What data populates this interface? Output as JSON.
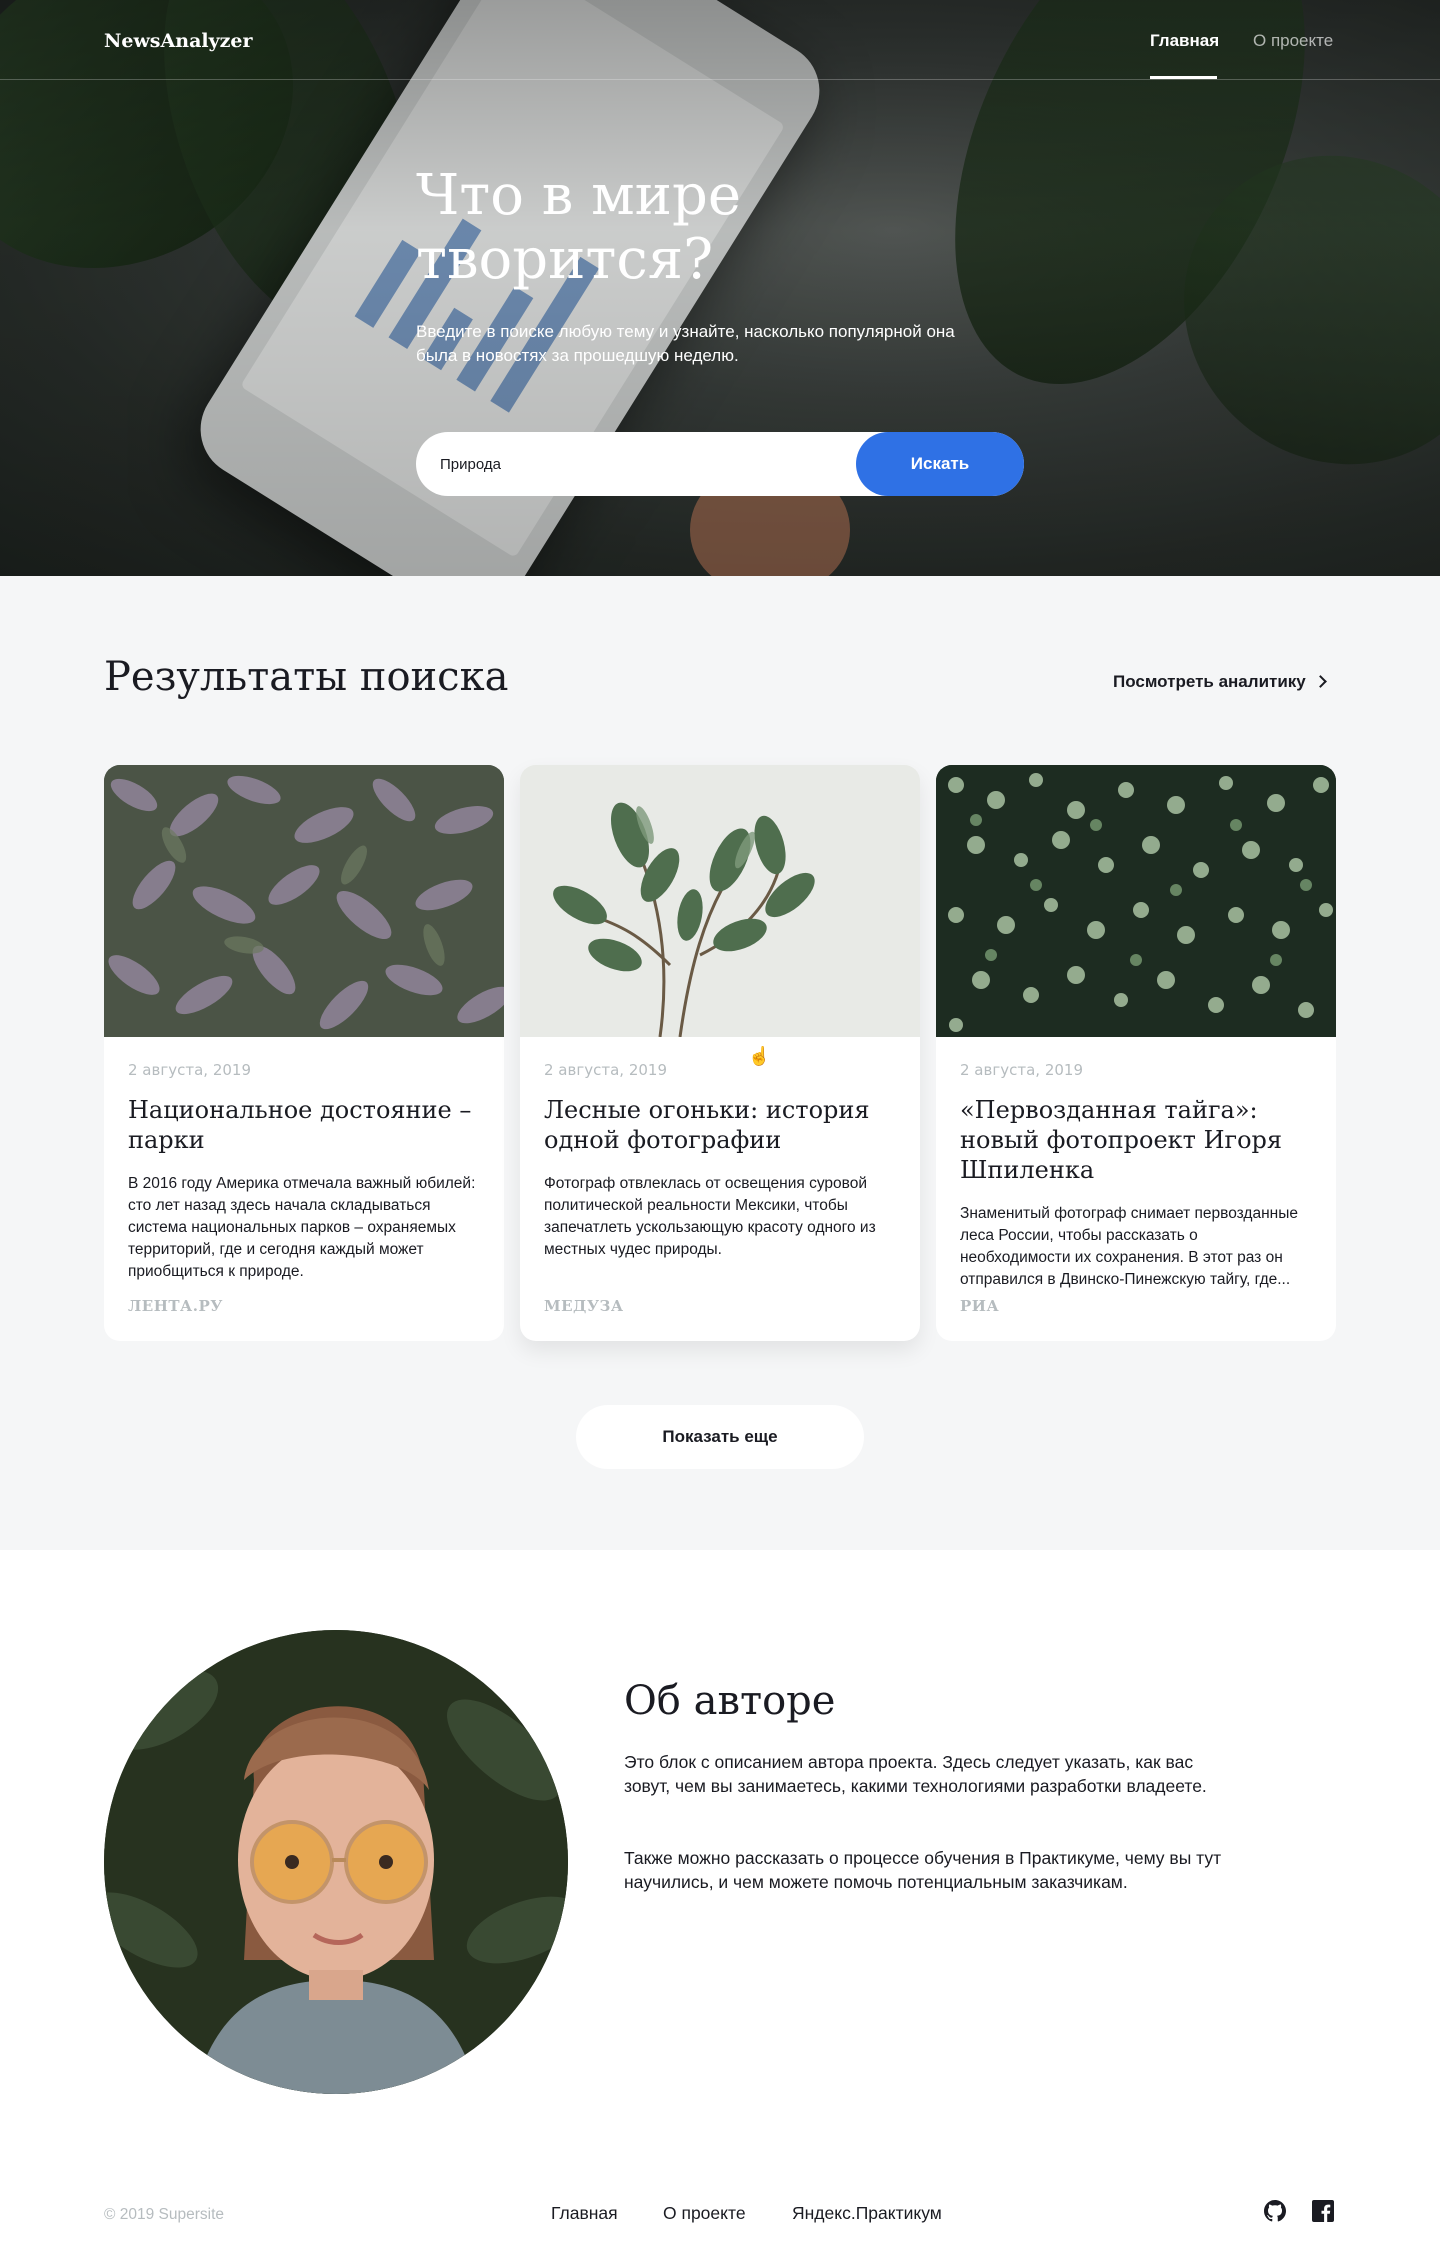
{
  "header": {
    "logo": "NewsAnalyzer",
    "nav": [
      {
        "label": "Главная",
        "active": true
      },
      {
        "label": "О проекте",
        "active": false
      }
    ]
  },
  "hero": {
    "title": "Что в мире творится?",
    "subtitle": "Введите в поиске любую тему и узнайте, насколько популярной она была в новостях за прошедшую неделю.",
    "search_value": "Природа",
    "search_button": "Искать"
  },
  "results": {
    "title": "Результаты поиска",
    "analytics_link": "Посмотреть аналитику",
    "cards": [
      {
        "date": "2 августа, 2019",
        "title": "Национальное достояние – парки",
        "text": "В 2016 году Америка отмечала важный юбилей: сто лет назад здесь начала складываться система национальных парков – охраняемых территорий, где и сегодня каждый может приобщиться к природе.",
        "source": "ЛЕНТА.РУ"
      },
      {
        "date": "2 августа, 2019",
        "title": "Лесные огоньки: история одной фотографии",
        "text": "Фотограф отвлеклась от освещения суровой политической реальности Мексики, чтобы запечатлеть ускользающую красоту одного из местных чудес природы.",
        "source": "МЕДУЗА"
      },
      {
        "date": "2 августа, 2019",
        "title": "«Первозданная тайга»: новый фотопроект Игоря Шпиленка",
        "text": "Знаменитый фотограф снимает первозданные леса России, чтобы рассказать о необходимости их сохранения. В этот раз он отправился в Двинско-Пинежскую тайгу, где...",
        "source": "РИА"
      }
    ],
    "more_button": "Показать еще"
  },
  "about": {
    "title": "Об авторе",
    "paragraph1": "Это блок с описанием автора проекта. Здесь следует указать, как вас зовут, чем вы занимаетесь, какими технологиями разработки владеете.",
    "paragraph2": "Также можно рассказать о процессе обучения в Практикуме, чему вы тут научились, и чем можете помочь потенциальным заказчикам."
  },
  "footer": {
    "copyright": "© 2019  Supersite",
    "links": [
      "Главная",
      "О проекте",
      "Яндекс.Практикум"
    ],
    "icons": [
      "github-icon",
      "facebook-icon"
    ]
  },
  "colors": {
    "accent": "#2f71e5",
    "text": "#1a1b22",
    "muted": "#b6bcbf",
    "section_bg": "#f5f6f7"
  }
}
